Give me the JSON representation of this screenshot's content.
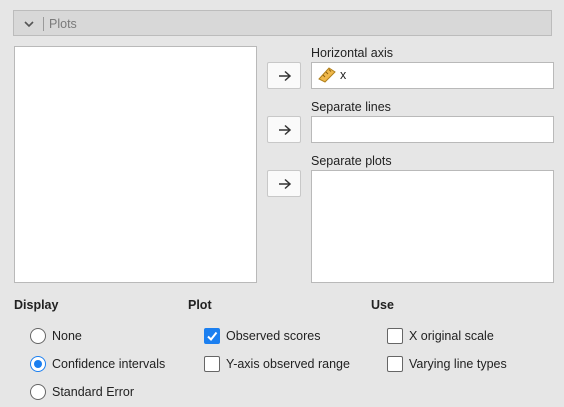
{
  "section": {
    "title": "Plots",
    "collapsed_icon": "chevron-down-icon"
  },
  "assign_buttons": {
    "icon": "arrow-right-icon"
  },
  "targets": {
    "horizontal_axis": {
      "label": "Horizontal axis",
      "items": [
        {
          "name": "x",
          "icon": "ruler-icon"
        }
      ]
    },
    "separate_lines": {
      "label": "Separate lines",
      "items": []
    },
    "separate_plots": {
      "label": "Separate plots",
      "items": []
    }
  },
  "display": {
    "heading": "Display",
    "options": [
      "None",
      "Confidence intervals",
      "Standard Error"
    ],
    "selected": "Confidence intervals"
  },
  "plot": {
    "heading": "Plot",
    "options": [
      {
        "label": "Observed scores",
        "checked": true
      },
      {
        "label": "Y-axis observed range",
        "checked": false
      }
    ]
  },
  "use": {
    "heading": "Use",
    "options": [
      {
        "label": "X original scale",
        "checked": false
      },
      {
        "label": "Varying line types",
        "checked": false
      }
    ]
  },
  "colors": {
    "accent": "#1b7ff0",
    "ruler": "#f0b84a"
  }
}
